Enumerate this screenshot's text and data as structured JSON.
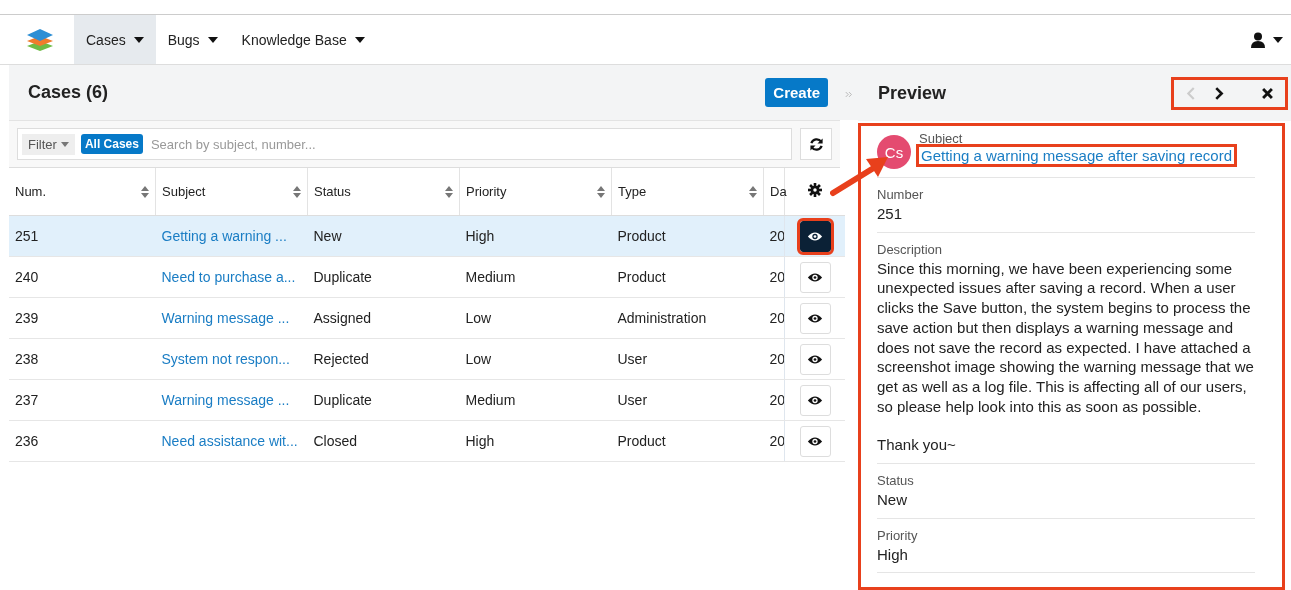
{
  "nav": {
    "items": [
      {
        "label": "Cases",
        "selected": true
      },
      {
        "label": "Bugs",
        "selected": false
      },
      {
        "label": "Knowledge Base",
        "selected": false
      }
    ]
  },
  "list": {
    "title": "Cases (6)",
    "create_button": "Create",
    "filter_button": "Filter",
    "filter_tag": "All Cases",
    "search": {
      "placeholder": "Search by subject, number..."
    },
    "columns": [
      "Num.",
      "Subject",
      "Status",
      "Priority",
      "Type",
      "Da"
    ],
    "rows": [
      {
        "num": "251",
        "subject": "Getting a warning ...",
        "status": "New",
        "priority": "High",
        "type": "Product",
        "column_6": "20",
        "selected": true,
        "callout": true
      },
      {
        "num": "240",
        "subject": "Need to purchase a...",
        "status": "Duplicate",
        "priority": "Medium",
        "type": "Product",
        "column_6": "20",
        "selected": false,
        "callout": false
      },
      {
        "num": "239",
        "subject": "Warning message ...",
        "status": "Assigned",
        "priority": "Low",
        "type": "Administration",
        "column_6": "20",
        "selected": false,
        "callout": false
      },
      {
        "num": "238",
        "subject": "System not respon...",
        "status": "Rejected",
        "priority": "Low",
        "type": "User",
        "column_6": "20",
        "selected": false,
        "callout": false
      },
      {
        "num": "237",
        "subject": "Warning message ...",
        "status": "Duplicate",
        "priority": "Medium",
        "type": "User",
        "column_6": "20",
        "selected": false,
        "callout": false
      },
      {
        "num": "236",
        "subject": "Need assistance wit...",
        "status": "Closed",
        "priority": "High",
        "type": "Product",
        "column_6": "20",
        "selected": false,
        "callout": false
      }
    ]
  },
  "preview": {
    "title": "Preview",
    "prev_disabled": true,
    "controls_callout": true,
    "body_callout": true,
    "avatar": "Cs",
    "subject": {
      "label": "Subject",
      "value": "Getting a warning message after saving record",
      "callout": true
    },
    "fields": [
      {
        "label": "Number",
        "paragraphs": [
          "251"
        ]
      },
      {
        "label": "Description",
        "paragraphs": [
          "Since this morning, we have been experiencing some unexpected issues after saving a record. When a user clicks the Save button, the system begins to process the save action but then displays a warning message and does not save the record as expected. I have attached a screenshot image showing the warning message that we get as well as a log file. This is affecting all of our users, so please help look into this as soon as possible.",
          "Thank you~"
        ]
      },
      {
        "label": "Status",
        "paragraphs": [
          "New"
        ]
      },
      {
        "label": "Priority",
        "paragraphs": [
          "High"
        ]
      }
    ]
  }
}
